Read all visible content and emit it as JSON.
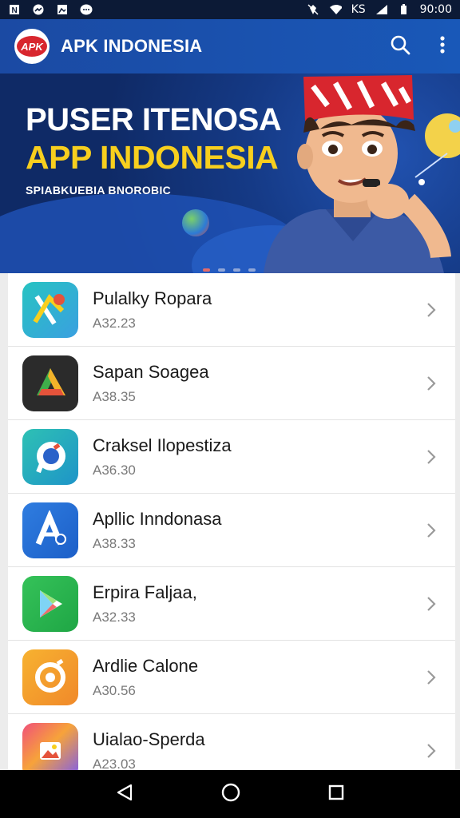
{
  "status_bar": {
    "time": "90:00",
    "net_label": "KS"
  },
  "app_bar": {
    "logo_text": "APK",
    "title": "APK INDONESIA"
  },
  "banner": {
    "line1": "PUSER ITENOSA",
    "line2": "APP INDONESIA",
    "line3": "SPIABKUEBIA BNOROBIC",
    "slide_count": 4,
    "active_slide": 0
  },
  "apps": [
    {
      "name": "Pulalky Ropara",
      "version": "A32.23",
      "icon": "pencil-brush-icon"
    },
    {
      "name": "Sapan Soagea",
      "version": "A38.35",
      "icon": "drive-triangle-icon"
    },
    {
      "name": "Craksel Ilopestiza",
      "version": "A36.30",
      "icon": "compass-chat-icon"
    },
    {
      "name": "Apllic Inndonasa",
      "version": "A38.33",
      "icon": "letter-a-icon"
    },
    {
      "name": "Erpira Faljaa,",
      "version": "A32.33",
      "icon": "play-store-icon"
    },
    {
      "name": "Ardlie Calone",
      "version": "A30.56",
      "icon": "camera-lens-icon"
    },
    {
      "name": "Uialao-Sperda",
      "version": "A23.03",
      "icon": "gallery-icon"
    }
  ],
  "colors": {
    "primary": "#1b4aa3",
    "accent": "#f7cf1e",
    "brand_red": "#d8262e"
  }
}
